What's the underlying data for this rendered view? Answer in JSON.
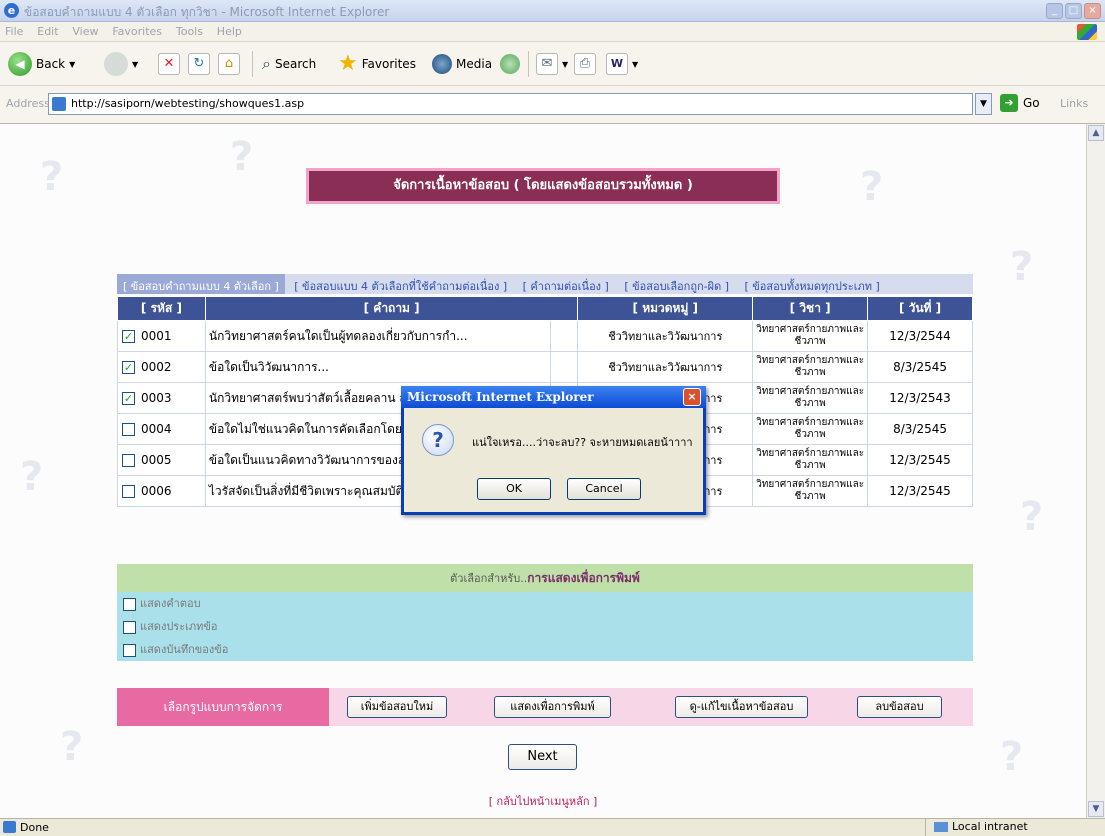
{
  "window": {
    "title": "ข้อสอบคำถามแบบ 4 ตัวเลือก ทุกวิชา - Microsoft Internet Explorer"
  },
  "menu": [
    "File",
    "Edit",
    "View",
    "Favorites",
    "Tools",
    "Help"
  ],
  "toolbar": {
    "back": "Back",
    "search": "Search",
    "favorites": "Favorites",
    "media": "Media"
  },
  "address": {
    "label": "Address",
    "url": "http://sasiporn/webtesting/showques1.asp",
    "go": "Go",
    "links": "Links"
  },
  "page": {
    "banner": "จัดการเนื้อหาข้อสอบ ( โดยแสดงข้อสอบรวมทั้งหมด )",
    "tabs": [
      "[ ข้อสอบคำถามแบบ 4 ตัวเลือก ]",
      "[ ข้อสอบแบบ 4 ตัวเลือกที่ใช้คำถามต่อเนื่อง ]",
      "[ คำถามต่อเนื่อง ]",
      "[ ข้อสอบเลือกถูก-ผิด ]",
      "[ ข้อสอบทั้งหมดทุกประเภท ]"
    ],
    "columns": {
      "id": "[ รหัส ]",
      "question": "[ คำถาม ]",
      "category": "[ หมวดหมู่ ]",
      "subject": "[ วิชา ]",
      "date": "[ วันที่ ]"
    },
    "rows": [
      {
        "checked": true,
        "id": "0001",
        "question": "นักวิทยาศาสตร์คนใดเป็นผู้ทดลองเกี่ยวกับการกำ...",
        "category": "ชีววิทยาและวิวัฒนาการ",
        "subject": "วิทยาศาสตร์กายภาพและชีวภาพ",
        "date": "12/3/2544"
      },
      {
        "checked": true,
        "id": "0002",
        "question": "ข้อใดเป็นวิวัฒนาการ...",
        "category": "ชีววิทยาและวิวัฒนาการ",
        "subject": "วิทยาศาสตร์กายภาพและชีวภาพ",
        "date": "8/3/2545"
      },
      {
        "checked": true,
        "id": "0003",
        "question": "นักวิทยาศาสตร์พบว่าสัตว์เลื้อยคลาน สัตว์...",
        "category": "ชีววิทยาและวิวัฒนาการ",
        "subject": "วิทยาศาสตร์กายภาพและชีวภาพ",
        "date": "12/3/2543"
      },
      {
        "checked": false,
        "id": "0004",
        "question": "ข้อใดไม่ใช่แนวคิดในการคัดเลือกโดยธรรมชาติ...",
        "category": "ชีววิทยาและวิวัฒนาการ",
        "subject": "วิทยาศาสตร์กายภาพและชีวภาพ",
        "date": "8/3/2545"
      },
      {
        "checked": false,
        "id": "0005",
        "question": "ข้อใดเป็นแนวคิดทางวิวัฒนาการของลามาร์ก...",
        "category": "ชีววิทยาและวิวัฒนาการ",
        "subject": "วิทยาศาสตร์กายภาพและชีวภาพ",
        "date": "12/3/2545"
      },
      {
        "checked": false,
        "id": "0006",
        "question": "ไวรัสจัดเป็นสิ่งที่มีชีวิตเพราะคุณสมบัติข้อใด...",
        "category": "ชีววิทยาและวิวัฒนาการ",
        "subject": "วิทยาศาสตร์กายภาพและชีวภาพ",
        "date": "12/3/2545"
      }
    ],
    "options_heading_prefix": "ตัวเลือกสำหรับ..",
    "options_heading_bold": "การแสดงเพื่อการพิมพ์",
    "options": [
      "แสดงคำตอบ",
      "แสดงประเภทข้อ",
      "แสดงบันทึกของข้อ"
    ],
    "action_label": "เลือกรูปแบบการจัดการ",
    "actions": {
      "add": "เพิ่มข้อสอบใหม่",
      "print": "แสดงเพื่อการพิมพ์",
      "edit": "ดู-แก้ไขเนื้อหาข้อสอบ",
      "delete": "ลบข้อสอบ"
    },
    "next": "Next",
    "home_link": "[ กลับไปหน้าเมนูหลัก ]"
  },
  "dialog": {
    "title": "Microsoft Internet Explorer",
    "message": "แน่ใจเหรอ....ว่าจะลบ?? จะหายหมดเลยน้าาาา",
    "ok": "OK",
    "cancel": "Cancel"
  },
  "status": {
    "text": "Done",
    "zone": "Local intranet"
  }
}
